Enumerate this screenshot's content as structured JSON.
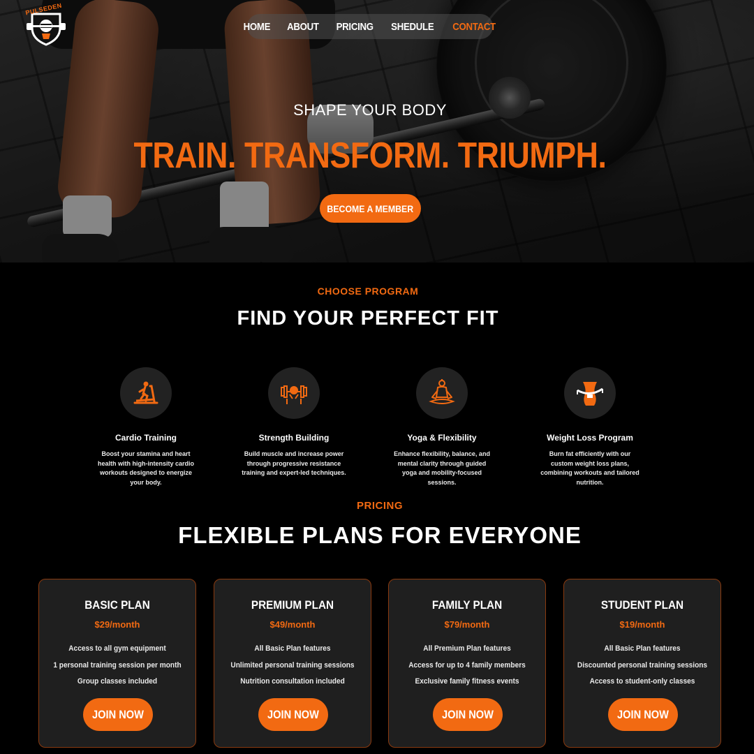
{
  "brand": {
    "name": "PULSEDEN",
    "accent": "#f26a12"
  },
  "nav": {
    "items": [
      {
        "label": "HOME"
      },
      {
        "label": "ABOUT"
      },
      {
        "label": "PRICING"
      },
      {
        "label": "SHEDULE"
      },
      {
        "label": "CONTACT",
        "active": true
      }
    ]
  },
  "hero": {
    "subtitle": "SHAPE YOUR BODY",
    "title": "TRAIN. TRANSFORM. TRIUMPH.",
    "cta": "BECOME A MEMBER"
  },
  "programs": {
    "eyebrow": "CHOOSE PROGRAM",
    "title": "FIND YOUR PERFECT FIT",
    "items": [
      {
        "icon": "treadmill-icon",
        "title": "Cardio Training",
        "desc": "Boost your stamina and heart health with high-intensity cardio workouts designed to energize your body."
      },
      {
        "icon": "dumbbell-flex-icon",
        "title": "Strength Building",
        "desc": "Build muscle and increase power through progressive resistance training and expert-led techniques."
      },
      {
        "icon": "yoga-meditation-icon",
        "title": "Yoga & Flexibility",
        "desc": "Enhance flexibility, balance, and mental clarity through guided yoga and mobility-focused sessions."
      },
      {
        "icon": "waist-measure-icon",
        "title": "Weight Loss Program",
        "desc": "Burn fat efficiently with our custom weight loss plans, combining workouts and tailored nutrition."
      }
    ]
  },
  "pricing": {
    "eyebrow": "PRICING",
    "title": "FLEXIBLE PLANS FOR EVERYONE",
    "plans": [
      {
        "name": "BASIC PLAN",
        "price": "$29/month",
        "features": [
          "Access to all gym equipment",
          "1 personal training session per month",
          "Group classes included"
        ],
        "cta": "JOIN NOW"
      },
      {
        "name": "PREMIUM PLAN",
        "price": "$49/month",
        "features": [
          "All Basic Plan features",
          "Unlimited personal training sessions",
          "Nutrition consultation included"
        ],
        "cta": "JOIN NOW"
      },
      {
        "name": "FAMILY PLAN",
        "price": "$79/month",
        "features": [
          "All Premium Plan features",
          "Access for up to 4 family members",
          "Exclusive family fitness events"
        ],
        "cta": "JOIN NOW"
      },
      {
        "name": "STUDENT PLAN",
        "price": "$19/month",
        "features": [
          "All Basic Plan features",
          "Discounted personal training sessions",
          "Access to student-only classes"
        ],
        "cta": "JOIN NOW"
      }
    ]
  }
}
